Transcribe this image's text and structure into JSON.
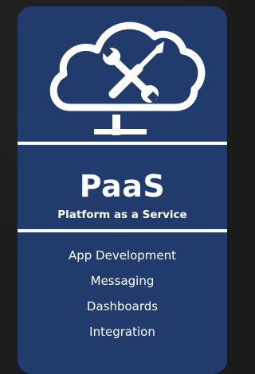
{
  "card": {
    "title": "PaaS",
    "subtitle": "Platform as a Service",
    "icon": "cloud-tools-icon",
    "background_color": "#213c6c",
    "text_color": "#ffffff"
  },
  "services": [
    {
      "label": "App Development"
    },
    {
      "label": "Messaging"
    },
    {
      "label": "Dashboards"
    },
    {
      "label": "Integration"
    }
  ]
}
